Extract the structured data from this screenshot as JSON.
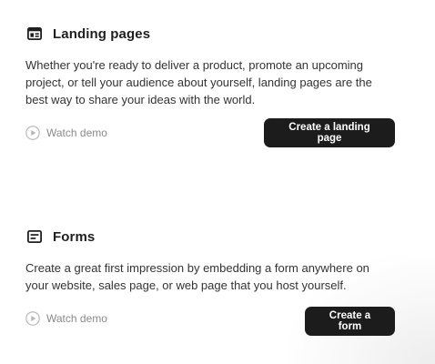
{
  "sections": [
    {
      "icon": "layout-icon",
      "title": "Landing pages",
      "description": "Whether you're ready to deliver a product, promote an upcoming project, or tell your audience about yourself, landing pages are the best way to share your ideas with the world.",
      "watch_demo_label": "Watch demo",
      "cta_label": "Create a landing page"
    },
    {
      "icon": "form-icon",
      "title": "Forms",
      "description": "Create a great first impression by embedding a form anywhere on your website, sales page, or web page that you host yourself.",
      "watch_demo_label": "Watch demo",
      "cta_label": "Create a form"
    }
  ],
  "colors": {
    "text_primary": "#1f1f1f",
    "text_muted": "#8a8a8a",
    "button_bg": "#1c1c1c",
    "button_text": "#ffffff"
  }
}
